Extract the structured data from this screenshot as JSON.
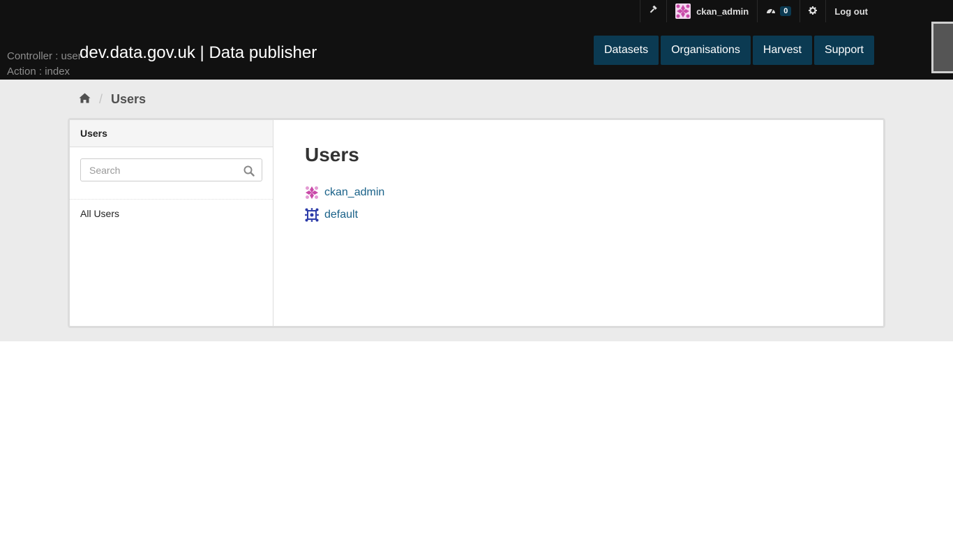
{
  "header": {
    "site_title": "dev.data.gov.uk | Data publisher",
    "debug": {
      "controller": "Controller : user",
      "action": "Action : index"
    },
    "account": {
      "username": "ckan_admin",
      "activity_count": "0",
      "logout_label": "Log out"
    },
    "nav": [
      {
        "label": "Datasets"
      },
      {
        "label": "Organisations"
      },
      {
        "label": "Harvest"
      },
      {
        "label": "Support"
      }
    ]
  },
  "breadcrumb": {
    "home_icon": "home-icon",
    "current": "Users"
  },
  "sidebar": {
    "heading": "Users",
    "search": {
      "placeholder": "Search",
      "value": ""
    },
    "link_all_users": "All Users"
  },
  "main": {
    "title": "Users",
    "users": [
      {
        "name": "ckan_admin",
        "avatar_color": "#c94aa8"
      },
      {
        "name": "default",
        "avatar_color": "#2b3aa8"
      }
    ]
  },
  "colors": {
    "header_bg": "#111111",
    "nav_bg": "#0b3a52",
    "link": "#1a6289",
    "band_bg": "#ebebeb"
  }
}
